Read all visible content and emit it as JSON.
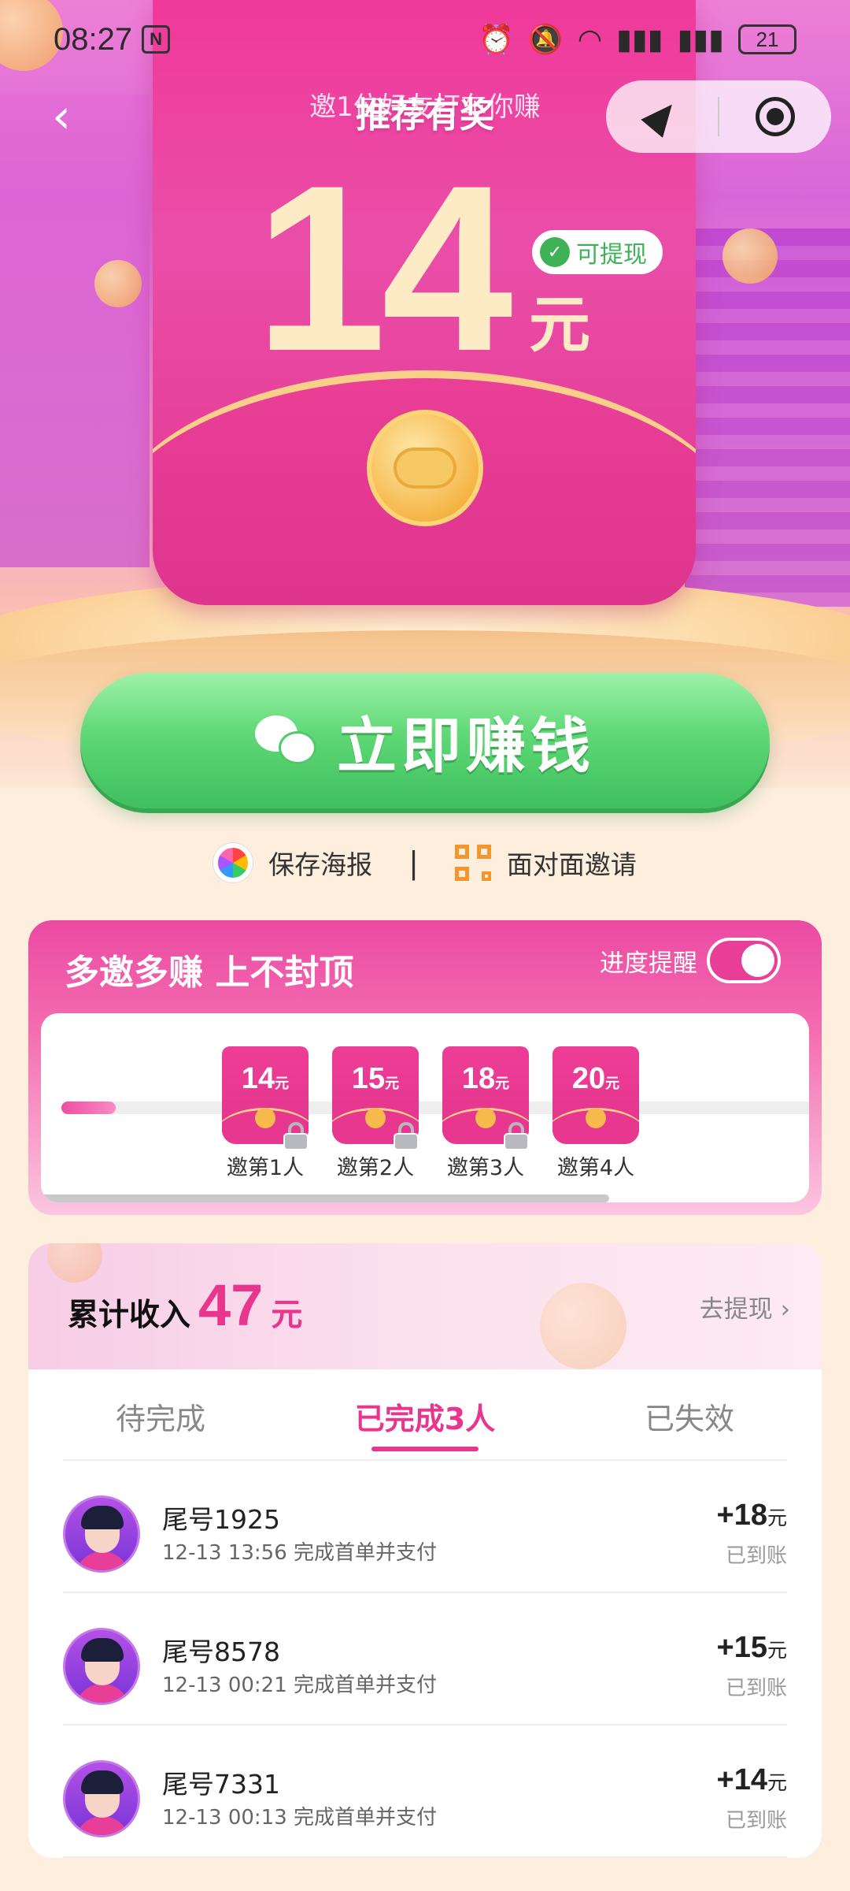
{
  "status_bar": {
    "time": "08:27",
    "nfc": "N",
    "battery": "21"
  },
  "hero": {
    "subtitle": "邀1位好友打车你赚",
    "title": "推荐有奖",
    "amount": "14",
    "unit": "元",
    "withdraw_badge": "可提现"
  },
  "cta": {
    "label": "立即赚钱"
  },
  "links": {
    "save_poster": "保存海报",
    "separator": "|",
    "face_invite": "面对面邀请"
  },
  "milestones": {
    "title": "多邀多赚 上不封顶",
    "reminder_label": "进度提醒",
    "reminder_on": true,
    "progress": 0.07,
    "steps": [
      {
        "amount": "14",
        "unit": "元",
        "label": "邀第1人"
      },
      {
        "amount": "15",
        "unit": "元",
        "label": "邀第2人"
      },
      {
        "amount": "18",
        "unit": "元",
        "label": "邀第3人"
      },
      {
        "amount": "20",
        "unit": "元",
        "label": "邀第4人"
      }
    ]
  },
  "income": {
    "label": "累计收入",
    "amount": "47",
    "unit": "元",
    "withdraw_link": "去提现 ›"
  },
  "tabs": [
    {
      "label": "待完成",
      "active": false
    },
    {
      "label": "已完成3人",
      "active": true
    },
    {
      "label": "已失效",
      "active": false
    }
  ],
  "records": [
    {
      "name": "尾号1925",
      "desc": "12-13 13:56 完成首单并支付",
      "amount": "+18",
      "unit": "元",
      "status": "已到账"
    },
    {
      "name": "尾号8578",
      "desc": "12-13 00:21 完成首单并支付",
      "amount": "+15",
      "unit": "元",
      "status": "已到账"
    },
    {
      "name": "尾号7331",
      "desc": "12-13 00:13 完成首单并支付",
      "amount": "+14",
      "unit": "元",
      "status": "已到账"
    }
  ],
  "colors": {
    "accent": "#e8358e",
    "cta_green": "#4fc96a",
    "envelope": "#ec3f98"
  }
}
